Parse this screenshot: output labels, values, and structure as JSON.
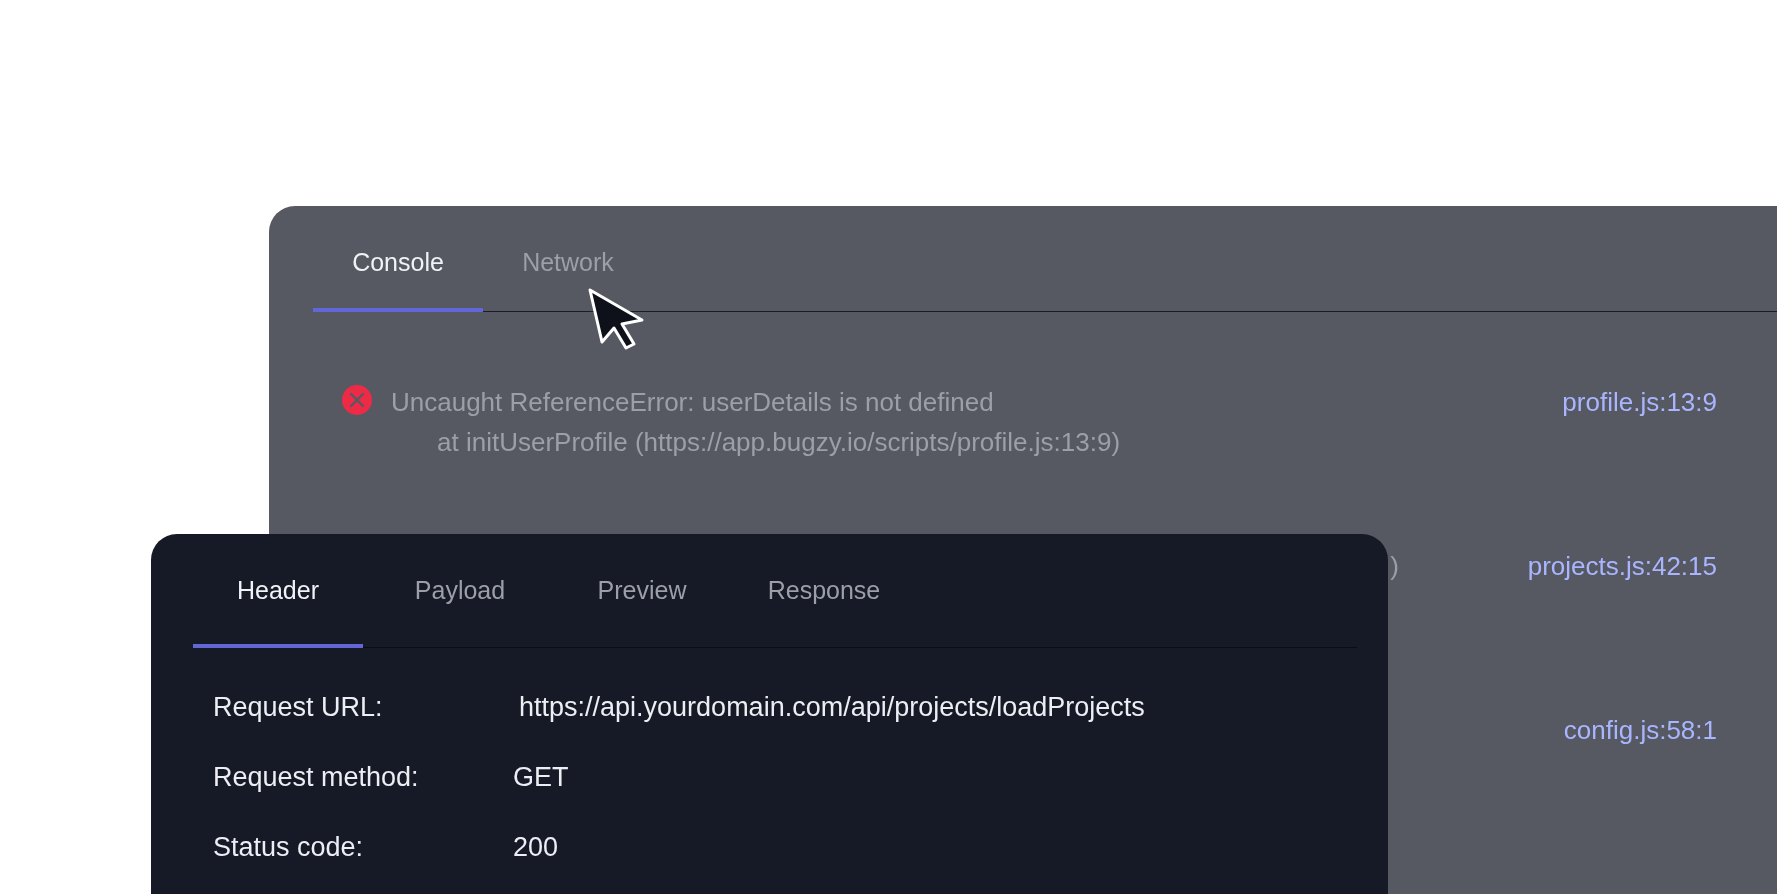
{
  "console_panel": {
    "tabs": [
      {
        "label": "Console",
        "selected": true
      },
      {
        "label": "Network",
        "selected": false
      }
    ],
    "rows": [
      {
        "kind": "error",
        "message": [
          "Uncaught ReferenceError: userDetails is not defined",
          "at initUserProfile (https://app.bugzy.io/scripts/profile.js:13:9)"
        ],
        "source": "profile.js:13:9"
      },
      {
        "kind": "covered",
        "message": [
          ")"
        ],
        "source": "projects.js:42:15"
      },
      {
        "kind": "covered",
        "message": [],
        "source": "config.js:58:1"
      }
    ]
  },
  "network_panel": {
    "tabs": [
      {
        "label": "Header",
        "selected": true
      },
      {
        "label": "Payload",
        "selected": false
      },
      {
        "label": "Preview",
        "selected": false
      },
      {
        "label": "Response",
        "selected": false
      }
    ],
    "fields": [
      {
        "label": "Request URL:",
        "value": "https://api.yourdomain.com/api/projects/loadProjects"
      },
      {
        "label": "Request method:",
        "value": "GET"
      },
      {
        "label": "Status code:",
        "value": "200"
      }
    ]
  }
}
